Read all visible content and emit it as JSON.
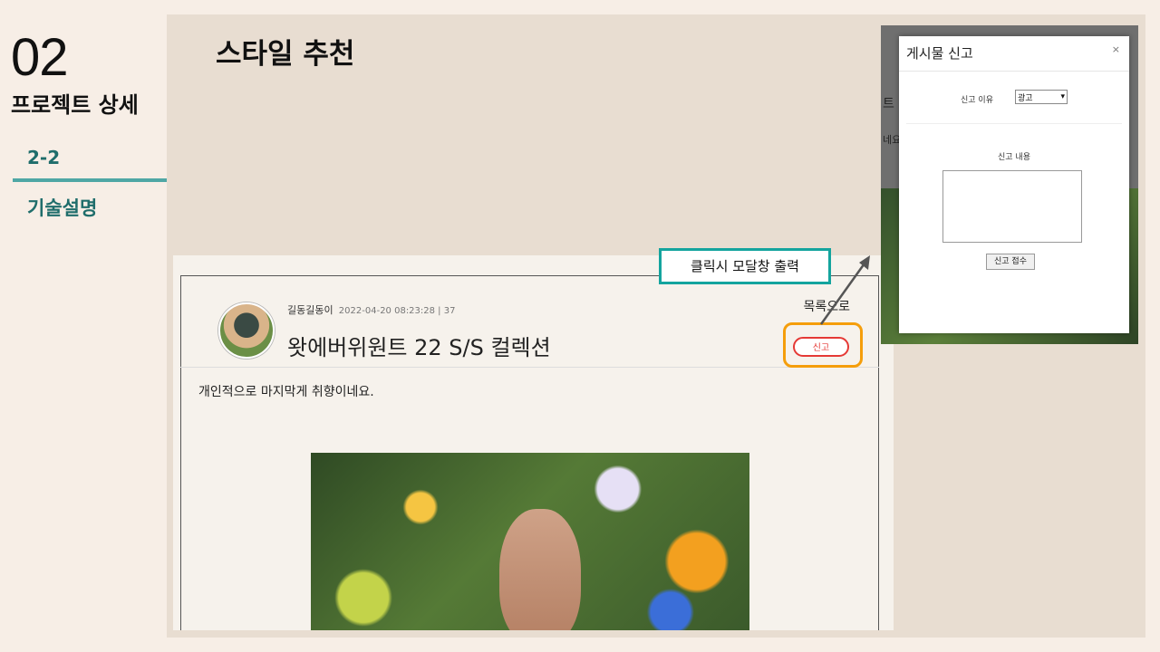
{
  "sidebar": {
    "number": "02",
    "section": "프로젝트 상세",
    "subnumber": "2-2",
    "subtitle": "기술설명"
  },
  "main": {
    "heading": "스타일 추천"
  },
  "post": {
    "author": "길동길동이",
    "meta": "2022-04-20 08:23:28 | 37",
    "title": "왓에버위원트 22 S/S 컬렉션",
    "list_link": "목록으로",
    "report_label": "신고",
    "body": "개인적으로 마지막게 취향이네요."
  },
  "annotation": {
    "callout": "클릭시 모달창 출력"
  },
  "modal": {
    "bg_text1": "트",
    "bg_text2": "네요.",
    "title": "게시물 신고",
    "close": "×",
    "reason_label": "신고 이유",
    "reason_value": "광고",
    "content_label": "신고 내용",
    "submit_label": "신고 접수"
  },
  "colors": {
    "accent_teal": "#14a49e",
    "highlight_orange": "#f59e0b",
    "report_red": "#e53935"
  }
}
